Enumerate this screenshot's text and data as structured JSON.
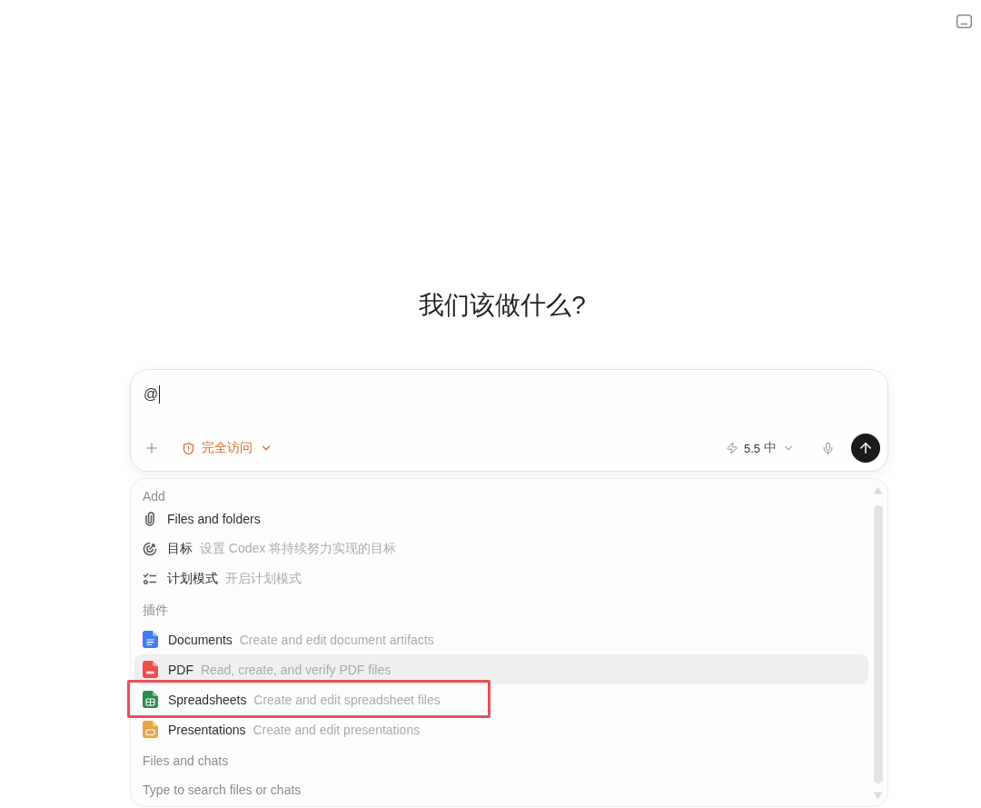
{
  "heading": "我们该做什么?",
  "composer": {
    "value": "@",
    "access": {
      "label": "完全访问"
    },
    "model": {
      "version": "5.5",
      "effort": "中"
    }
  },
  "menu": {
    "sections": [
      {
        "title": "Add",
        "items": [
          {
            "kind": "files",
            "label": "Files and folders",
            "selected": false,
            "annotated": false
          },
          {
            "kind": "goal",
            "label": "目标",
            "description": "设置 Codex 将持续努力实现的目标",
            "selected": false,
            "annotated": false
          },
          {
            "kind": "plan",
            "label": "计划模式",
            "description": "开启计划模式",
            "selected": false,
            "annotated": false
          }
        ]
      },
      {
        "title": "插件",
        "items": [
          {
            "kind": "documents",
            "label": "Documents",
            "description": "Create and edit document artifacts",
            "selected": false,
            "annotated": false
          },
          {
            "kind": "pdf",
            "label": "PDF",
            "description": "Read, create, and verify PDF files",
            "selected": true,
            "annotated": false
          },
          {
            "kind": "spreadsheets",
            "label": "Spreadsheets",
            "description": "Create and edit spreadsheet files",
            "selected": false,
            "annotated": true
          },
          {
            "kind": "presentations",
            "label": "Presentations",
            "description": "Create and edit presentations",
            "selected": false,
            "annotated": false
          }
        ]
      },
      {
        "title": "Files and chats",
        "hint": "Type to search files or chats"
      }
    ]
  }
}
